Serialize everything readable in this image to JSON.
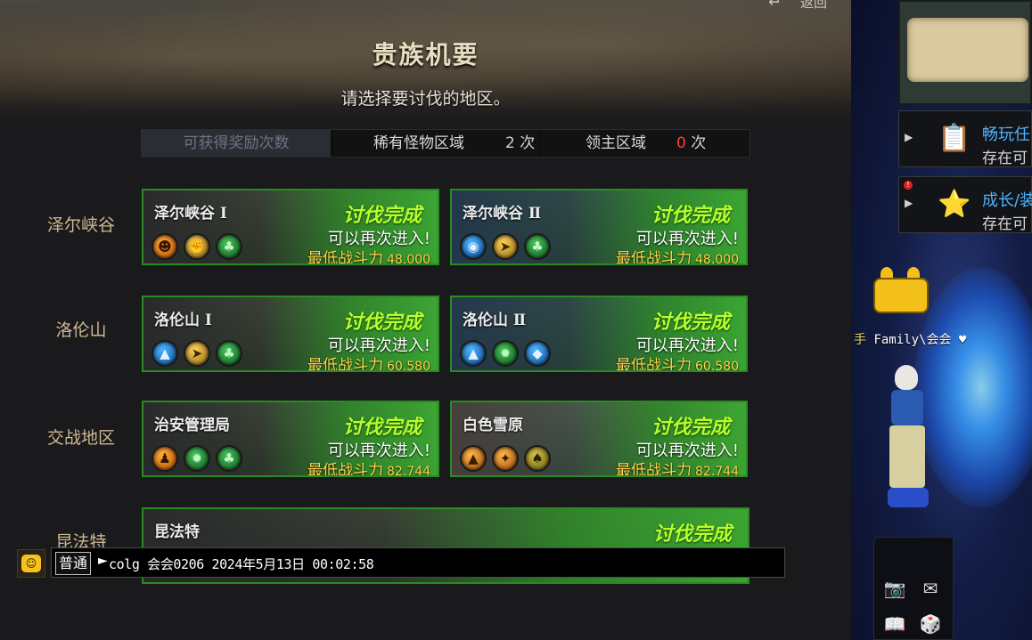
{
  "header": {
    "title": "贵族机要",
    "subtitle": "请选择要讨伐的地区。",
    "return_label": "返回",
    "return_icon": "return-arrow-icon"
  },
  "reward_bar": {
    "label": "可获得奖励次数",
    "rare_zone": {
      "name": "稀有怪物区域",
      "count": "2",
      "unit": "次"
    },
    "boss_zone": {
      "name": "领主区域",
      "count": "0",
      "unit": "次"
    }
  },
  "regions": [
    {
      "name": "泽尔峡谷"
    },
    {
      "name": "洛伦山"
    },
    {
      "name": "交战地区"
    },
    {
      "name": "昆法特"
    }
  ],
  "cards": [
    {
      "name": "泽尔峡谷 Ⅰ",
      "status": "讨伐完成",
      "reenter": "可以再次进入!",
      "power_label": "最低战斗力",
      "power": "48,000",
      "icons": [
        {
          "name": "orange-mask-icon",
          "glyph": "☻"
        },
        {
          "name": "gold-fist-icon",
          "glyph": "✊"
        },
        {
          "name": "green-club-icon",
          "glyph": "♣"
        }
      ]
    },
    {
      "name": "泽尔峡谷 Ⅱ",
      "status": "讨伐完成",
      "reenter": "可以再次进入!",
      "power_label": "最低战斗力",
      "power": "48,000",
      "icons": [
        {
          "name": "blue-helmet-icon",
          "glyph": "◉"
        },
        {
          "name": "gold-boot-icon",
          "glyph": "➤"
        },
        {
          "name": "green-club-icon",
          "glyph": "♣"
        }
      ]
    },
    {
      "name": "洛伦山 Ⅰ",
      "status": "讨伐完成",
      "reenter": "可以再次进入!",
      "power_label": "最低战斗力",
      "power": "60,580",
      "icons": [
        {
          "name": "blue-spire-icon",
          "glyph": "▲"
        },
        {
          "name": "gold-boot-icon",
          "glyph": "➤"
        },
        {
          "name": "green-club-icon",
          "glyph": "♣"
        }
      ]
    },
    {
      "name": "洛伦山 Ⅱ",
      "status": "讨伐完成",
      "reenter": "可以再次进入!",
      "power_label": "最低战斗力",
      "power": "60,580",
      "icons": [
        {
          "name": "blue-spire-icon",
          "glyph": "▲"
        },
        {
          "name": "green-gear-icon",
          "glyph": "✹"
        },
        {
          "name": "blue-diamond-icon",
          "glyph": "◆"
        }
      ]
    },
    {
      "name": "治安管理局",
      "status": "讨伐完成",
      "reenter": "可以再次进入!",
      "power_label": "最低战斗力",
      "power": "82,744",
      "icons": [
        {
          "name": "orange-figure-icon",
          "glyph": "♟"
        },
        {
          "name": "green-gear-icon",
          "glyph": "✹"
        },
        {
          "name": "green-club-icon",
          "glyph": "♣"
        }
      ]
    },
    {
      "name": "白色雪原",
      "status": "讨伐完成",
      "reenter": "可以再次进入!",
      "power_label": "最低战斗力",
      "power": "82,744",
      "icons": [
        {
          "name": "amber-spire-icon",
          "glyph": "▲"
        },
        {
          "name": "amber-torch-icon",
          "glyph": "✦"
        },
        {
          "name": "olive-spade-icon",
          "glyph": "♠"
        }
      ]
    },
    {
      "name": "昆法特",
      "status": "讨伐完成"
    }
  ],
  "chat": {
    "channel": "普通",
    "message": "colg 会会0206 2024年5月13日 00:02:58"
  },
  "quests": [
    {
      "title": "畅玩任",
      "subtitle": "存在可",
      "icon": "clipboard-icon",
      "alert": false
    },
    {
      "title": "成长/装",
      "subtitle": "存在可",
      "icon": "star-book-icon",
      "alert": true,
      "alert_text": "!"
    }
  ],
  "character": {
    "name_prefix": "手",
    "name": "Family\\会会",
    "suffix_icon": "heart-icon"
  },
  "colors": {
    "status_green": "#b8ff2a",
    "power_yellow": "#ffd54a",
    "boss_count_red": "#ff3b3b",
    "quest_blue": "#4fb2ff",
    "card_border": "#2a8a23"
  }
}
